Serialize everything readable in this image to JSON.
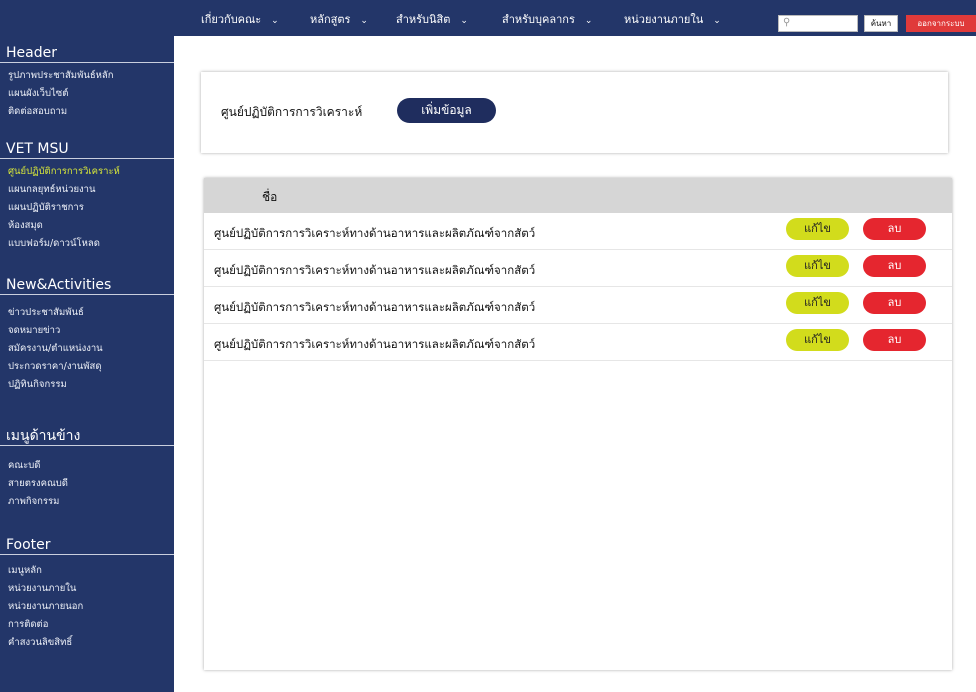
{
  "nav": {
    "items": [
      {
        "label": "เกี่ยวกับคณะ"
      },
      {
        "label": "หลักสูตร"
      },
      {
        "label": "สำหรับนิสิต"
      },
      {
        "label": "สำหรับบุคลากร"
      },
      {
        "label": "หน่วยงานภายใน"
      }
    ],
    "search_label": "ค้นหา",
    "logout_label": "ออกจากระบบ"
  },
  "sidebar": {
    "sections": [
      {
        "title": "Header",
        "items": [
          "รูปภาพประชาสัมพันธ์หลัก",
          "แผนผังเว็บไซต์",
          "ติดต่อสอบถาม"
        ]
      },
      {
        "title": "VET MSU",
        "items": [
          "ศูนย์ปฏิบัติการการวิเคราะห์",
          "แผนกลยุทธ์หน่วยงาน",
          "แผนปฏิบัติราชการ",
          "ห้องสมุด",
          "แบบฟอร์ม/ดาวน์โหลด"
        ]
      },
      {
        "title": "New&Activities",
        "items": [
          "ข่าวประชาสัมพันธ์",
          "จดหมายข่าว",
          "สมัครงาน/ตำแหน่งงาน",
          "ประกวดราคา/งานพัสดุ",
          "ปฏิทินกิจกรรม"
        ]
      },
      {
        "title": "เมนูด้านข้าง",
        "items": [
          "คณะบดี",
          "สายตรงคณบดี",
          "ภาพกิจกรรม"
        ]
      },
      {
        "title": "Footer",
        "items": [
          "เมนูหลัก",
          "หน่วยงานภายใน",
          "หน่วยงานภายนอก",
          "การติดต่อ",
          "คำสงวนลิขสิทธิ์"
        ]
      }
    ],
    "active_item": "ศูนย์ปฏิบัติการการวิเคราะห์"
  },
  "form": {
    "label": "ศูนย์ปฏิบัติการการวิเคราะห์",
    "add_button": "เพิ่มข้อมูล"
  },
  "table": {
    "column_name": "ชื่อ",
    "edit_label": "แก้ไข",
    "delete_label": "ลบ",
    "rows": [
      {
        "name": "ศูนย์ปฏิบัติการการวิเคราะห์ทางด้านอาหารและผลิตภัณฑ์จากสัตว์"
      },
      {
        "name": "ศูนย์ปฏิบัติการการวิเคราะห์ทางด้านอาหารและผลิตภัณฑ์จากสัตว์"
      },
      {
        "name": "ศูนย์ปฏิบัติการการวิเคราะห์ทางด้านอาหารและผลิตภัณฑ์จากสัตว์"
      },
      {
        "name": "ศูนย์ปฏิบัติการการวิเคราะห์ทางด้านอาหารและผลิตภัณฑ์จากสัตว์"
      }
    ]
  },
  "icons": {
    "search": "search-icon",
    "nav_chevron": "chevron-down-icon"
  },
  "colors": {
    "sidebar_bg": "#233669",
    "add_button": "#1f2d5e",
    "edit_button": "#d2dc1c",
    "delete_button": "#e5262f",
    "logout_button": "#e03a3a",
    "active_item": "#d7e63a"
  }
}
